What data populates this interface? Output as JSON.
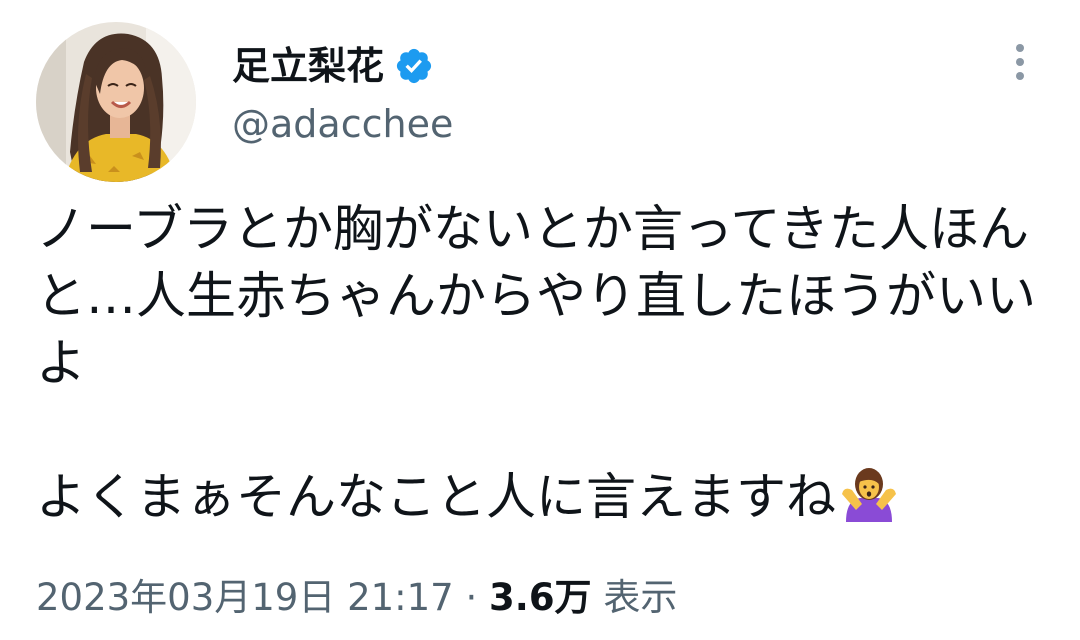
{
  "tweet": {
    "author": {
      "display_name": "足立梨花",
      "handle": "@adacchee",
      "verified": true,
      "verified_icon": "verified-badge-icon",
      "avatar_icon": "profile-avatar"
    },
    "text": {
      "line1": "ノーブラとか胸がないとか言ってきた人ほんと…人生赤ちゃんからやり直したほうがいいよ",
      "line2": "よくまぁそんなこと人に言えますね",
      "emoji": "woman-shrugging-emoji"
    },
    "meta": {
      "timestamp": "2023年03月19日 21:17",
      "separator": " · ",
      "views_count": "3.6万",
      "views_label": " 表示"
    },
    "more_icon": "more-vertical-icon"
  },
  "colors": {
    "text_primary": "#0f1419",
    "text_secondary": "#536471",
    "verified_blue": "#1d9bf0",
    "background": "#ffffff"
  }
}
